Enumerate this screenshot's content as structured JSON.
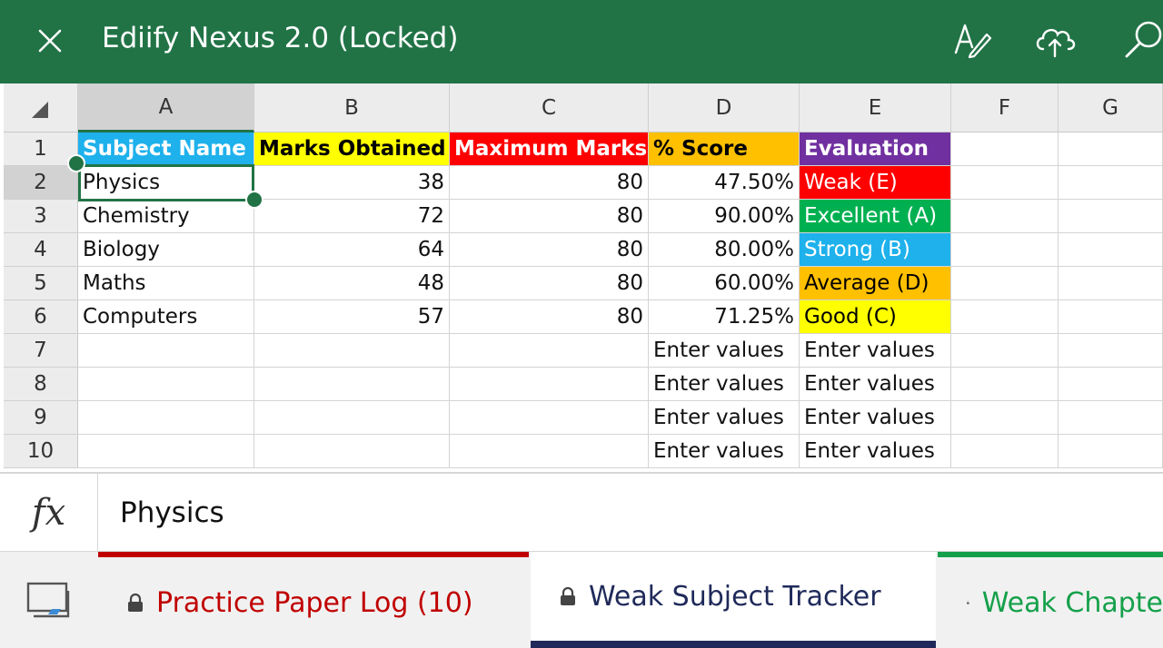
{
  "app": {
    "title": "Ediify Nexus 2.0 (Locked)"
  },
  "toolbar": {
    "icons": [
      "close-icon",
      "draw-icon",
      "cloud-upload-icon",
      "search-icon"
    ]
  },
  "grid": {
    "columns": [
      "A",
      "B",
      "C",
      "D",
      "E",
      "F",
      "G"
    ],
    "rows": [
      "1",
      "2",
      "3",
      "4",
      "5",
      "6",
      "7",
      "8",
      "9",
      "10"
    ],
    "header": [
      "Subject Name",
      "Marks Obtained",
      "Maximum Marks",
      "% Score",
      "Evaluation"
    ],
    "data": [
      [
        "Physics",
        "38",
        "80",
        "47.50%",
        "Weak (E)"
      ],
      [
        "Chemistry",
        "72",
        "80",
        "90.00%",
        "Excellent (A)"
      ],
      [
        "Biology",
        "64",
        "80",
        "80.00%",
        "Strong (B)"
      ],
      [
        "Maths",
        "48",
        "80",
        "60.00%",
        "Average (D)"
      ],
      [
        "Computers",
        "57",
        "80",
        "71.25%",
        "Good (C)"
      ],
      [
        "",
        "",
        "",
        "Enter values",
        "Enter values"
      ],
      [
        "",
        "",
        "",
        "Enter values",
        "Enter values"
      ],
      [
        "",
        "",
        "",
        "Enter values",
        "Enter values"
      ],
      [
        "",
        "",
        "",
        "Enter values",
        "Enter values"
      ]
    ],
    "selected_cell": "A2",
    "colors": {
      "header_fill": [
        "#1eb1ec",
        "#ffff00",
        "#ff0000",
        "#ffc000",
        "#7030a0"
      ],
      "header_text": [
        "#ffffff",
        "#000000",
        "#ffffff",
        "#000000",
        "#ffffff"
      ],
      "evaluation_fill": [
        "#ff0000",
        "#00b050",
        "#1eb1ec",
        "#ffc000",
        "#ffff00"
      ],
      "evaluation_text": [
        "#ffffff",
        "#ffffff",
        "#ffffff",
        "#000000",
        "#000000"
      ]
    }
  },
  "formula_bar": {
    "icon_text": "fx",
    "content": "Physics"
  },
  "tabs": [
    {
      "label": "Practice Paper Log (10)",
      "locked": true,
      "color": "#c00000"
    },
    {
      "label": "Weak Subject Tracker",
      "locked": true,
      "color": "#1f2a5a",
      "active": true
    },
    {
      "label": "Weak Chapte",
      "locked": true,
      "color": "#14a04a"
    }
  ]
}
